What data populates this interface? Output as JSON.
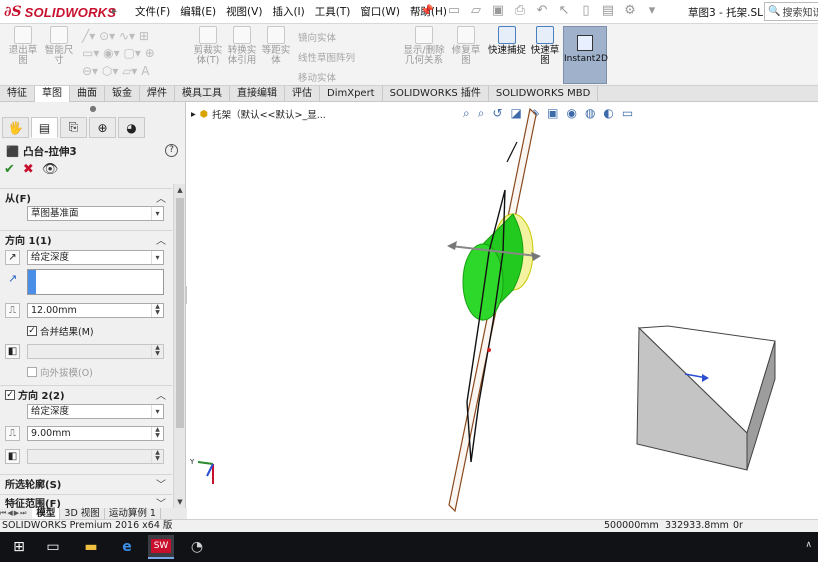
{
  "app": {
    "brand": "SOLIDWORKS",
    "menus": [
      "文件(F)",
      "编辑(E)",
      "视图(V)",
      "插入(I)",
      "工具(T)",
      "窗口(W)",
      "帮助(H)"
    ],
    "doc_title": "草图3 - 托架.SL...",
    "search_placeholder": "搜索知识"
  },
  "commands": {
    "exit_sketch": "退出草图",
    "smart_dim": "智能尺寸",
    "mirror": "镜向实体",
    "linear_pattern": "线性草图阵列",
    "move": "移动实体",
    "trim": "剪裁实体(T)",
    "convert": "转换实体引用",
    "offset": "等距实体",
    "display_delete": "显示/删除几何关系",
    "repair": "修复草图",
    "quick_snap": "快速捕捉",
    "rapid_sketch": "快速草图",
    "instant2d": "Instant2D"
  },
  "tabs": [
    "特征",
    "草图",
    "曲面",
    "钣金",
    "焊件",
    "模具工具",
    "直接编辑",
    "评估",
    "DimXpert",
    "SOLIDWORKS 插件",
    "SOLIDWORKS MBD"
  ],
  "pm": {
    "feature_title": "凸台-拉伸3",
    "from_label": "从(F)",
    "from_value": "草图基准面",
    "dir1_label": "方向 1(1)",
    "dir1_end": "给定深度",
    "dir1_depth": "12.00mm",
    "merge_label": "合并结果(M)",
    "draft_out_label": "向外拔模(O)",
    "dir2_label": "方向 2(2)",
    "dir2_end": "给定深度",
    "dir2_depth": "9.00mm",
    "selected_contours": "所选轮廓(S)",
    "features_label": "特征范围(F)"
  },
  "viewport": {
    "tree_label": "托架（默认<<默认>_显..."
  },
  "model_tabs": [
    "模型",
    "3D 视图",
    "运动算例 1"
  ],
  "status": {
    "left": "SOLIDWORKS Premium 2016 x64 版",
    "v1": "500000mm",
    "v2": "332933.8mm",
    "v3": "0r"
  },
  "colors": {
    "brand_red": "#c8102e",
    "cylinder_green": "#22c91e",
    "plane_brown": "#8a4a1e",
    "instant2d_bg": "#9fb1cb"
  }
}
